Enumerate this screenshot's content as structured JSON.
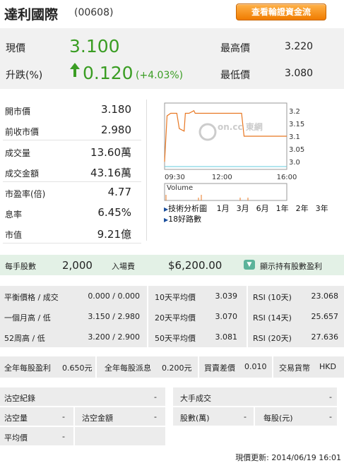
{
  "header": {
    "name": "達利國際",
    "code": "(00608)",
    "fund_flow_button": "查看輪證資金流"
  },
  "quote": {
    "price_label": "現價",
    "price": "3.100",
    "change_label": "升跌(%)",
    "change": "0.120",
    "change_pct": "(+4.03%)",
    "high_label": "最高價",
    "high": "3.220",
    "low_label": "最低價",
    "low": "3.080"
  },
  "stats": [
    {
      "label": "開市價",
      "value": "3.180"
    },
    {
      "label": "前收市價",
      "value": "2.980"
    },
    {
      "label": "成交量",
      "value": "13.60萬"
    },
    {
      "label": "成交金額",
      "value": "43.16萬"
    },
    {
      "label": "市盈率(倍)",
      "value": "4.77"
    },
    {
      "label": "息率",
      "value": "6.45%"
    },
    {
      "label": "市值",
      "value": "9.21億"
    }
  ],
  "chart": {
    "y_ticks": [
      "3.2",
      "3.15",
      "3.1",
      "3.05",
      "3.0"
    ],
    "x_ticks": [
      "09:30",
      "12:00",
      "16:00"
    ],
    "volume_label": "Volume",
    "watermark": "on.cc 東網",
    "series": [
      [
        0,
        3.0
      ],
      [
        0.02,
        3.18
      ],
      [
        0.05,
        3.19
      ],
      [
        0.1,
        3.19
      ],
      [
        0.12,
        3.13
      ],
      [
        0.16,
        3.12
      ],
      [
        0.17,
        3.19
      ],
      [
        0.2,
        3.19
      ],
      [
        0.24,
        3.2
      ],
      [
        0.25,
        3.19
      ],
      [
        0.63,
        3.19
      ],
      [
        0.65,
        3.1
      ],
      [
        1.0,
        3.1
      ]
    ]
  },
  "chart_links": {
    "tech": "技術分析圖",
    "ranges": [
      "1月",
      "3月",
      "6月",
      "1年",
      "2年",
      "3年"
    ],
    "news": "18好路數"
  },
  "lot": {
    "lot_label": "每手股數",
    "lot": "2,000",
    "entry_label": "入場費",
    "entry": "$6,200.00",
    "holding_btn": "顯示持有股數盈利"
  },
  "indicators": [
    {
      "a_label": "平衡價格 / 成交",
      "a_val": "0.000 / 0.000",
      "b_label": "10天平均價",
      "b_val": "3.039",
      "c_label": "RSI (10天)",
      "c_val": "23.068"
    },
    {
      "a_label": "一個月高 / 低",
      "a_val": "3.150 / 2.980",
      "b_label": "20天平均價",
      "b_val": "3.070",
      "c_label": "RSI (14天)",
      "c_val": "25.657"
    },
    {
      "a_label": "52周高 / 低",
      "a_val": "3.200 / 2.900",
      "b_label": "50天平均價",
      "b_val": "3.081",
      "c_label": "RSI (20天)",
      "c_val": "27.636"
    }
  ],
  "dividend": {
    "eps_label": "全年每股盈利",
    "eps": "0.650元",
    "dps_label": "全年每股派息",
    "dps": "0.200元",
    "spread_label": "買賣差價",
    "spread": "0.010",
    "ccy_label": "交易貨幣",
    "ccy": "HKD"
  },
  "short": {
    "record_label": "沽空紀錄",
    "record_val": "-",
    "big_label": "大手成交",
    "big_val": "-",
    "qty_label": "沽空量",
    "qty_val": "-",
    "amt_label": "沽空金額",
    "amt_val": "-",
    "shares_label": "股數(萬)",
    "shares_val": "-",
    "per_label": "每股(元)",
    "per_val": "-",
    "avg_label": "平均價",
    "avg_val": "-"
  },
  "updated": "現價更新: 2014/06/19 16:01"
}
